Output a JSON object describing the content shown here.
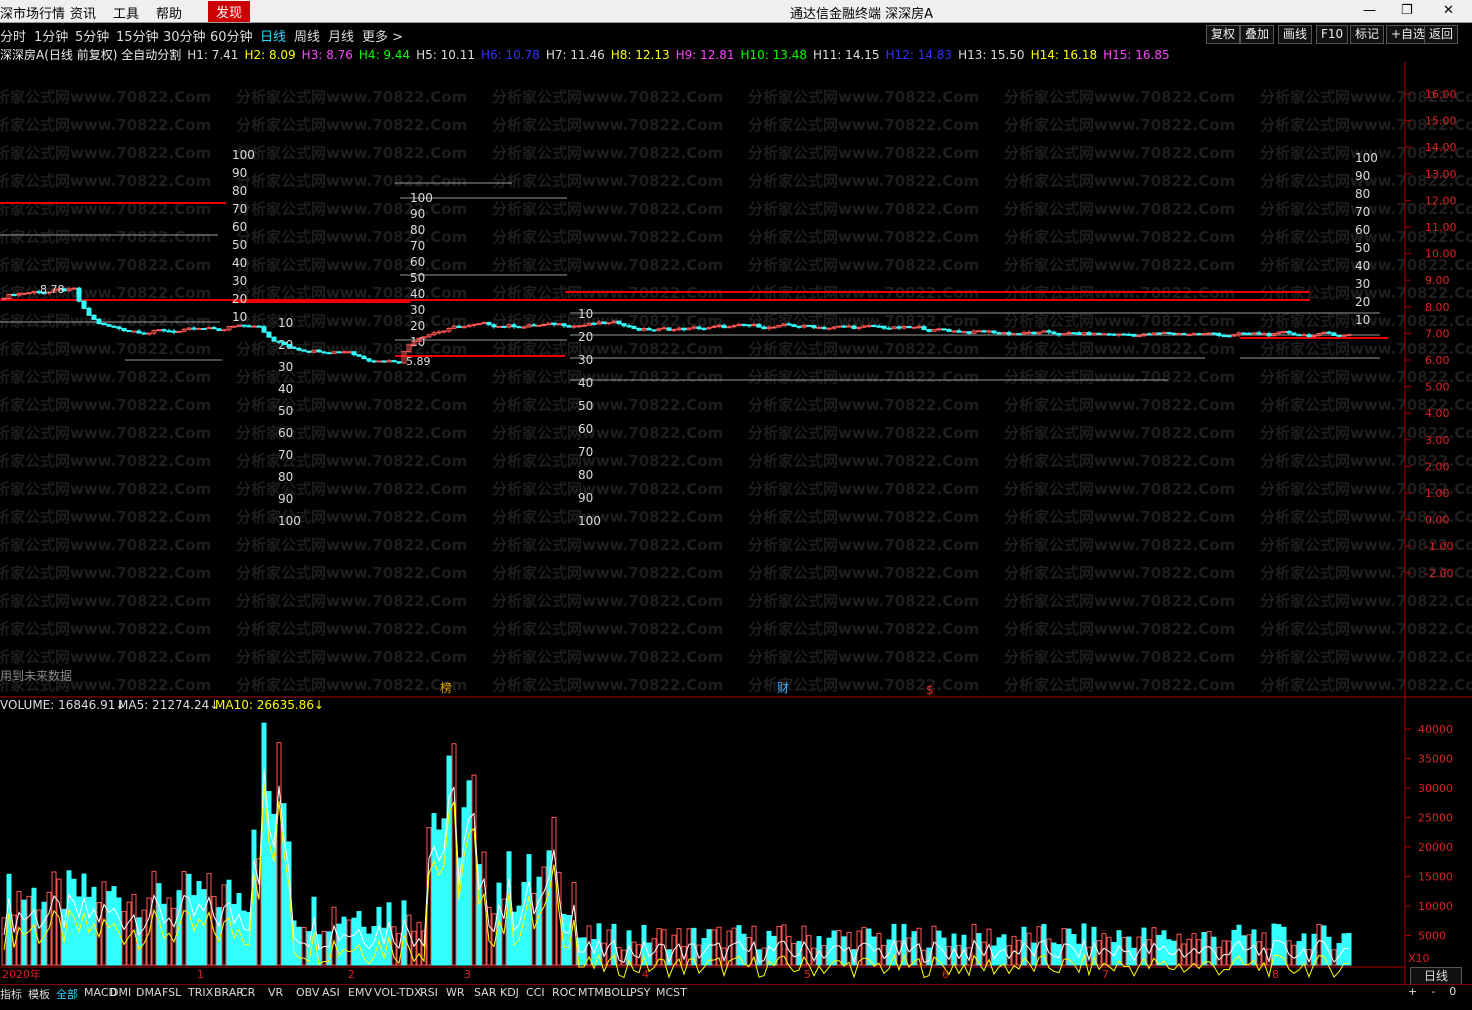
{
  "menu": {
    "items": [
      "深市场行情",
      "资讯",
      "工具",
      "帮助"
    ],
    "discover": "发现",
    "app_title": "通达信金融终端   深深房A"
  },
  "periods": [
    "分时",
    "1分钟",
    "5分钟",
    "15分钟",
    "30分钟",
    "60分钟",
    "日线",
    "周线",
    "月线",
    "更多 >"
  ],
  "active_period": "日线",
  "toolbar": [
    "复权",
    "叠加",
    "画线",
    "F10",
    "标记",
    "+自选",
    "返回"
  ],
  "info": {
    "stock": "深深房A(日线 前复权) 全自动分割",
    "levels": [
      {
        "label": "H1: 7.41",
        "color": "#dddddd"
      },
      {
        "label": "H2: 8.09",
        "color": "#ffff00"
      },
      {
        "label": "H3: 8.76",
        "color": "#ff44ff"
      },
      {
        "label": "H4: 9.44",
        "color": "#00ff00"
      },
      {
        "label": "H5: 10.11",
        "color": "#dddddd"
      },
      {
        "label": "H6: 10.78",
        "color": "#3333ff"
      },
      {
        "label": "H7: 11.46",
        "color": "#dddddd"
      },
      {
        "label": "H8: 12.13",
        "color": "#ffff00"
      },
      {
        "label": "H9: 12.81",
        "color": "#ff44ff"
      },
      {
        "label": "H10: 13.48",
        "color": "#00ff00"
      },
      {
        "label": "H11: 14.15",
        "color": "#dddddd"
      },
      {
        "label": "H12: 14.83",
        "color": "#3333ff"
      },
      {
        "label": "H13: 15.50",
        "color": "#dddddd"
      },
      {
        "label": "H14: 16.18",
        "color": "#ffff00"
      },
      {
        "label": "H15: 16.85",
        "color": "#ff44ff"
      }
    ]
  },
  "price_axis": [
    "16.00",
    "15.00",
    "14.00",
    "13.00",
    "12.00",
    "11.00",
    "10.00",
    "9.00",
    "8.00",
    "7.00",
    "6.00",
    "5.00",
    "4.00",
    "3.00",
    "2.00",
    "1.00",
    "0.00",
    "-1.00",
    "-2.00"
  ],
  "marks": {
    "high": "8.78",
    "low": "5.89"
  },
  "note_future": "用到未来数据",
  "event_marks": [
    "榜",
    "财",
    "$"
  ],
  "volume": {
    "label": "VOLUME: 16846.91",
    "ma5": "MA5: 21274.24",
    "ma10": "MA10: 26635.86",
    "axis": [
      "40000",
      "35000",
      "30000",
      "25000",
      "20000",
      "15000",
      "10000",
      "5000"
    ],
    "unit": "X10"
  },
  "dates": [
    "2020年",
    "1",
    "2",
    "3",
    "4",
    "5",
    "6",
    "7",
    "8"
  ],
  "scale_labels": [
    "100",
    "90",
    "80",
    "70",
    "60",
    "50",
    "40",
    "30",
    "20",
    "10"
  ],
  "indicators": [
    "指标",
    "模板",
    "全部",
    "MACD",
    "DMI",
    "DMA",
    "FSL",
    "TRIX",
    "BRAR",
    "CR",
    "VR",
    "OBV",
    "ASI",
    "EMV",
    "VOL-TDX",
    "RSI",
    "WR",
    "SAR",
    "KDJ",
    "CCI",
    "ROC",
    "MTM",
    "BOLL",
    "PSY",
    "MCST"
  ],
  "active_indicator": "全部",
  "period_label": "日线",
  "scroll": [
    "+",
    "-",
    "0"
  ],
  "watermark": "分析家公式网www.70822.Com"
}
